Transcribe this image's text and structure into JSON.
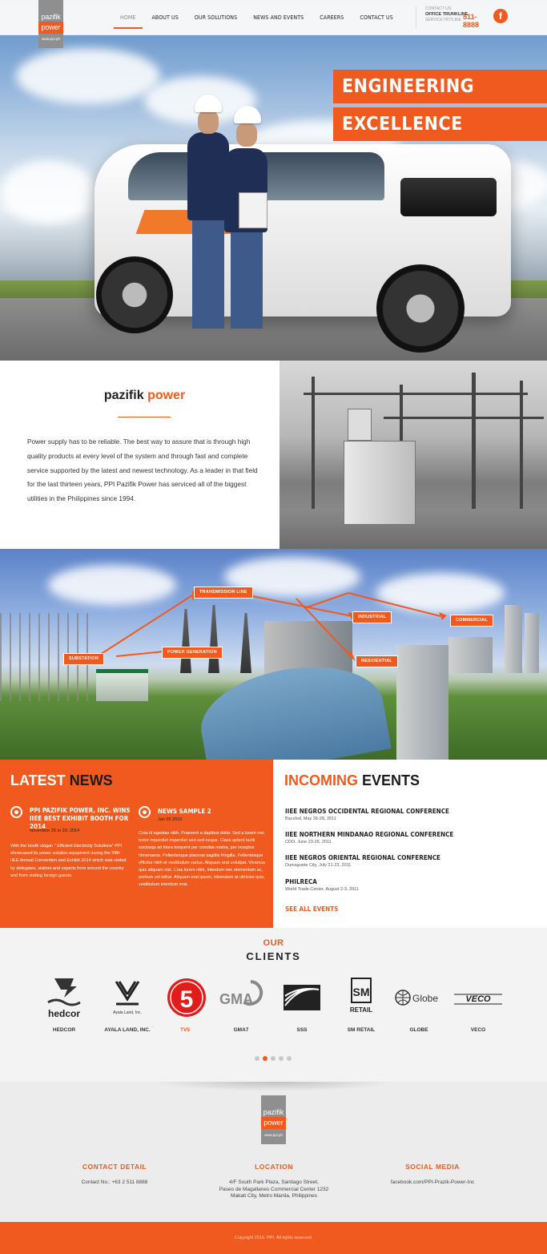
{
  "header": {
    "logo": {
      "line1": "pazifik",
      "line2": "power",
      "url": "www.ppi.ph"
    },
    "nav": [
      {
        "label": "HOME",
        "active": true
      },
      {
        "label": "ABOUT US",
        "active": false
      },
      {
        "label": "OUR SOLUTIONS",
        "active": false
      },
      {
        "label": "NEWS AND EVENTS",
        "active": false
      },
      {
        "label": "CAREERS",
        "active": false
      },
      {
        "label": "CONTACT US",
        "active": false
      }
    ],
    "contact": {
      "caption": "CONTACT US:",
      "line": "OFFICE TRUNKLINE",
      "hotline": "SERVICE HOTLINE",
      "number": "511-8888"
    },
    "social_icon": "facebook-icon"
  },
  "hero": {
    "banner_line1": "ENGINEERING",
    "banner_line2": "EXCELLENCE"
  },
  "about": {
    "title_part1": "pazifik",
    "title_part2": "power",
    "body": "Power supply has to be reliable. The best way to assure that is through high quality products at every level of the system and through fast and complete service supported by the latest and newest technology. As a leader in that field for the last thirteen years, PPI Pazifik Power has serviced all of the biggest utilities in the Philippines since 1994."
  },
  "diagram": {
    "labels": {
      "transmission": "TRANSMISSION LINE",
      "industrial": "INDUSTRIAL",
      "commercial": "COMMERCIAL",
      "substation": "SUBSTATION",
      "generation": "POWER GENERATION",
      "residential": "RESIDENTIAL"
    }
  },
  "news": {
    "heading_part1": "LATEST",
    "heading_part2": "NEWS",
    "items": [
      {
        "title": "PPI PAZIFIK POWER, INC. WINS IIEE BEST EXHIBIT BOOTH FOR 2014",
        "date": "November 26 to 29, 2014",
        "body": "With the booth slogan \" Efficient Electricity Solutions\" PPI showcased its power solution equipment during the 39th IIEE Annual Convention and Exhibit 2014 which was visited by delegates, visitors and experts from around the country and from visiting foreign guests."
      },
      {
        "title": "NEWS SAMPLE 2",
        "date": "Jan 05 2016",
        "body": "Cras id egestas nibh. Praesent a dapibus dolor. Sed a lorem nec tortor imperdiet imperdiet sed sed neque. Class aptent taciti sociosqu ad litora torquent per conubia nostra, per inceptos himenaeos. Pellentesque placerat sagittis fringilla. Pellentesque efficitur nibh et vestibulum varius. Aliquam erat volutpat. Vivamus quis aliquam nisi. Cras lorem nibh, interdum nec elementum ac, pretium vel tellus. Aliquam erat ipsum, bibendum at ultricies quis, vestibulum interdum erat."
      }
    ]
  },
  "events": {
    "heading_part1": "INCOMING",
    "heading_part2": "EVENTS",
    "items": [
      {
        "title": "IIEE NEGROS OCCIDENTAL REGIONAL CONFERENCE",
        "detail": "Bacolod, May 26-28, 2011"
      },
      {
        "title": "IIEE NORTHERN MINDANAO REGIONAL CONFERENCE",
        "detail": "CDO, June 23-25, 2011"
      },
      {
        "title": "IIEE NEGROS ORIENTAL REGIONAL CONFERENCE",
        "detail": "Dumaguete City, July 21-23, 2011"
      },
      {
        "title": "PHILRECA",
        "detail": "World Trade Center, August 2-3, 2011"
      }
    ],
    "see_all": "SEE ALL EVENTS"
  },
  "clients": {
    "heading_part1": "OUR",
    "heading_part2": "CLIENTS",
    "items": [
      {
        "name": "HEDCOR",
        "logo_text": "hedcor"
      },
      {
        "name": "AYALA LAND, INC.",
        "logo_text": "Ayala Land, Inc."
      },
      {
        "name": "TV5",
        "logo_text": "5"
      },
      {
        "name": "GMA7",
        "logo_text": "GMA"
      },
      {
        "name": "SSS",
        "logo_text": ""
      },
      {
        "name": "SM RETAIL",
        "logo_text": "SM"
      },
      {
        "name": "GLOBE",
        "logo_text": "Globe"
      },
      {
        "name": "VECO",
        "logo_text": "VECO"
      }
    ],
    "carousel_active": 2,
    "carousel_count": 5
  },
  "footer": {
    "logo": {
      "line1": "pazifik",
      "line2": "power",
      "url": "www.ppi.ph"
    },
    "contact_heading": "CONTACT DETAIL",
    "contact_value": "Contact No.: +63 2 511 8888",
    "location_heading": "LOCATION",
    "location_line1": "4/F South Park Plaza, Santiago Street,",
    "location_line2": "Paseo de Magallanes Commercial Center 1232",
    "location_line3": "Makati City, Metro Manila, Philippines",
    "social_heading": "SOCIAL MEDIA",
    "social_value": "facebook.com/PPI-Prazik-Power-Inc",
    "copyright": "Copyright 2016. PPI. All rights reserved."
  },
  "colors": {
    "accent": "#f05a1e",
    "dark": "#1c1c1c",
    "light_bg": "#f3f3f3"
  }
}
